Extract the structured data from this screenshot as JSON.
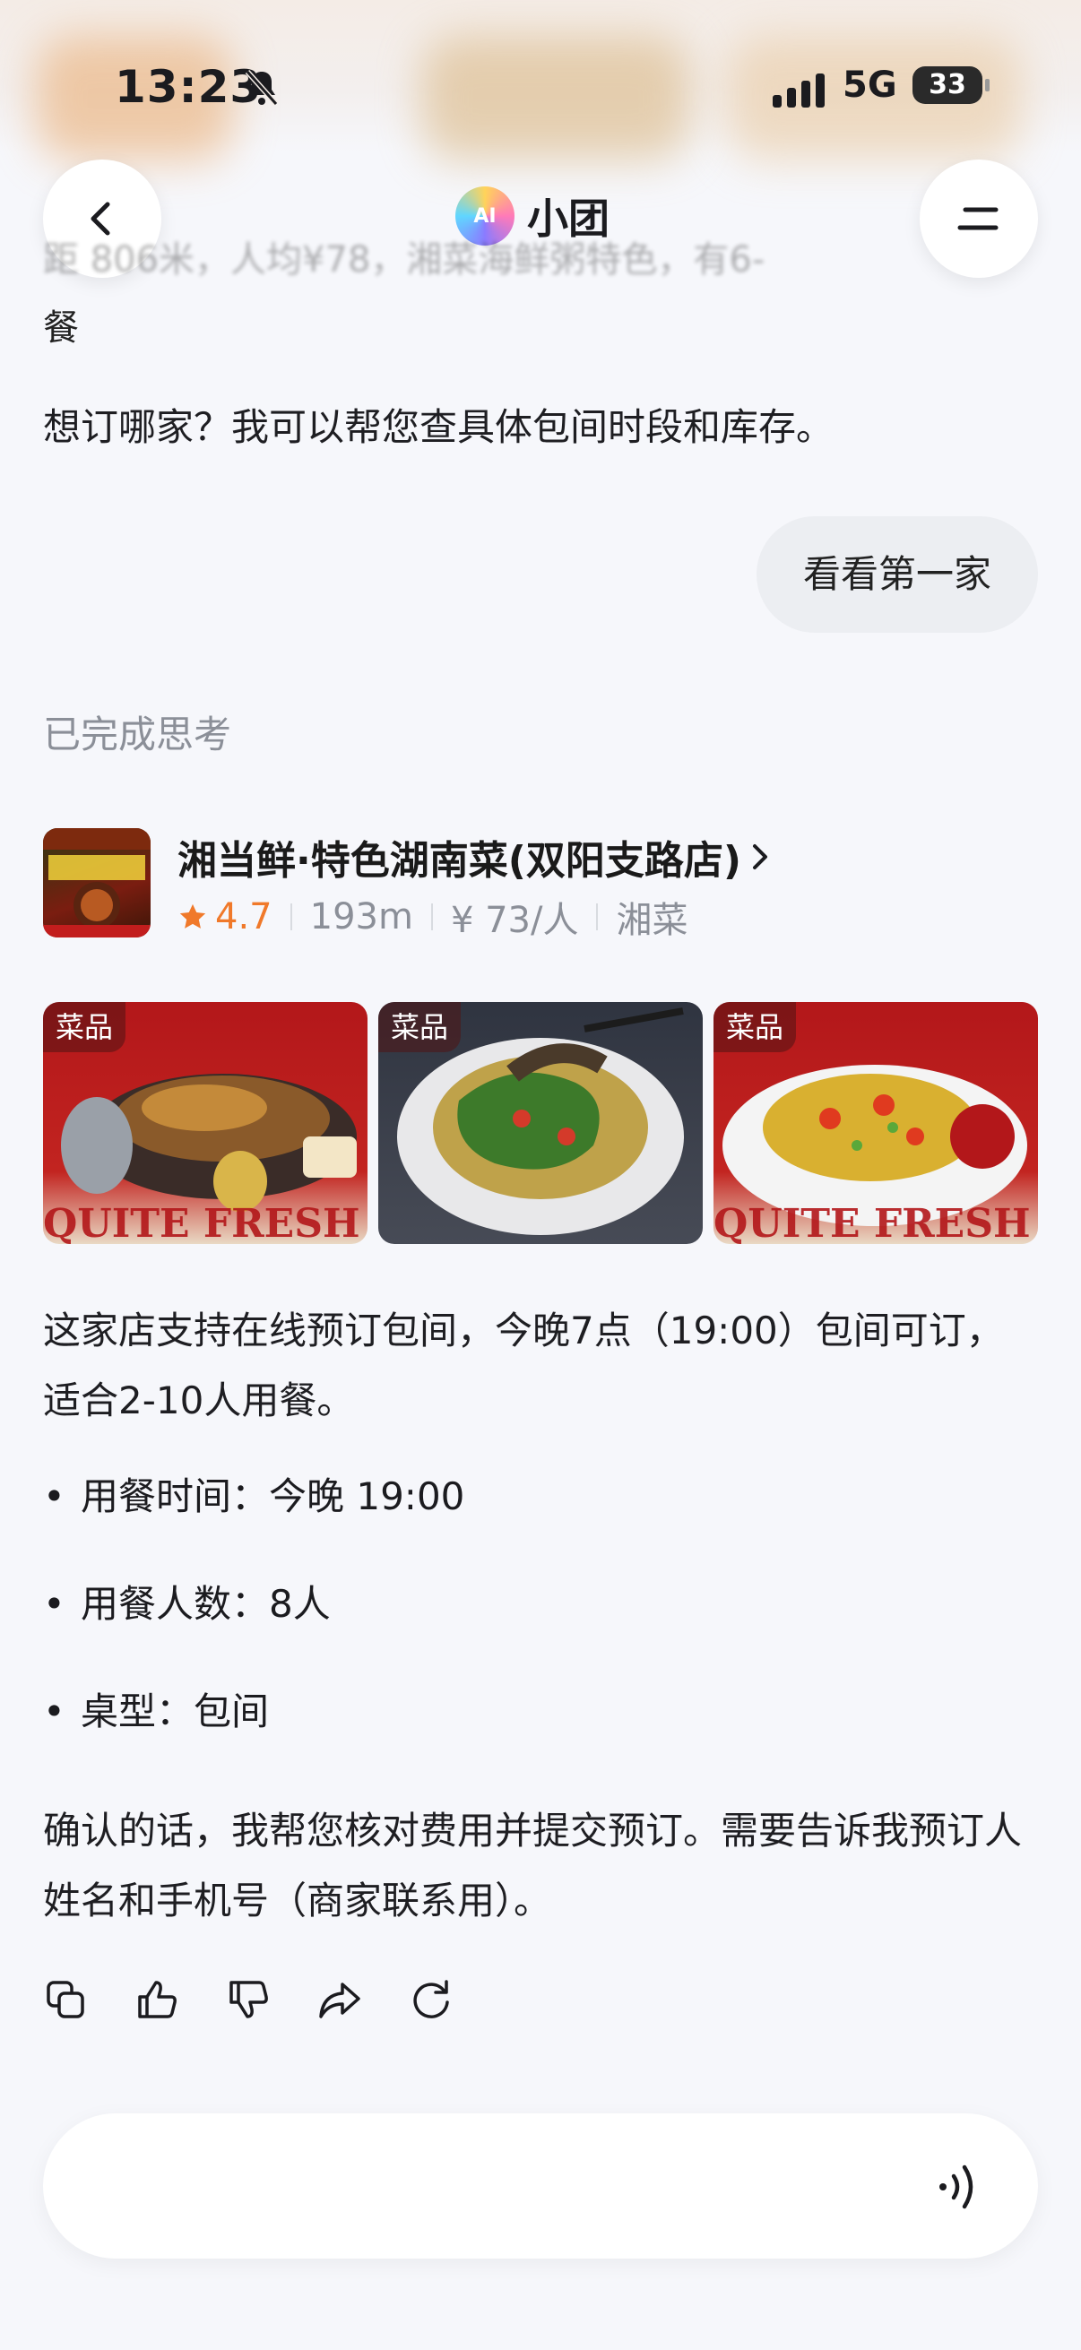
{
  "status_bar": {
    "time": "13:23",
    "network": "5G",
    "battery": "33"
  },
  "header": {
    "title": "小团",
    "logo_text": "AI"
  },
  "chat": {
    "cut_line_1": "距 806米，人均¥78，湘菜海鲜粥特色，有6-",
    "cut_line_2": "餐",
    "assistant_question": "想订哪家？我可以帮您查具体包间时段和库存。",
    "user_message": "看看第一家",
    "thinking_status": "已完成思考"
  },
  "shop": {
    "name": "湘当鲜·特色湖南菜(双阳支路店)",
    "rating": "4.7",
    "distance": "193m",
    "price_per_person": "¥ 73/人",
    "category": "湘菜"
  },
  "dishes": [
    {
      "tag": "菜品",
      "icon": "dish-chicken-pot-image"
    },
    {
      "tag": "菜品",
      "icon": "dish-stirfry-plate-image"
    },
    {
      "tag": "菜品",
      "icon": "dish-eggplant-image"
    }
  ],
  "reply": {
    "paragraph_1": "这家店支持在线预订包间，今晚7点（19:00）包间可订，适合2-10人用餐。",
    "items": [
      "用餐时间：今晚 19:00",
      "用餐人数：8人",
      "桌型：包间"
    ],
    "paragraph_2": "确认的话，我帮您核对费用并提交预订。需要告诉我预订人姓名和手机号（商家联系用）。"
  },
  "actions": [
    "copy-icon",
    "thumbs-up-icon",
    "thumbs-down-icon",
    "share-icon",
    "refresh-icon"
  ],
  "colors": {
    "accent": "#f0792a",
    "background": "#f6f7fb",
    "muted": "#8b8f98"
  }
}
